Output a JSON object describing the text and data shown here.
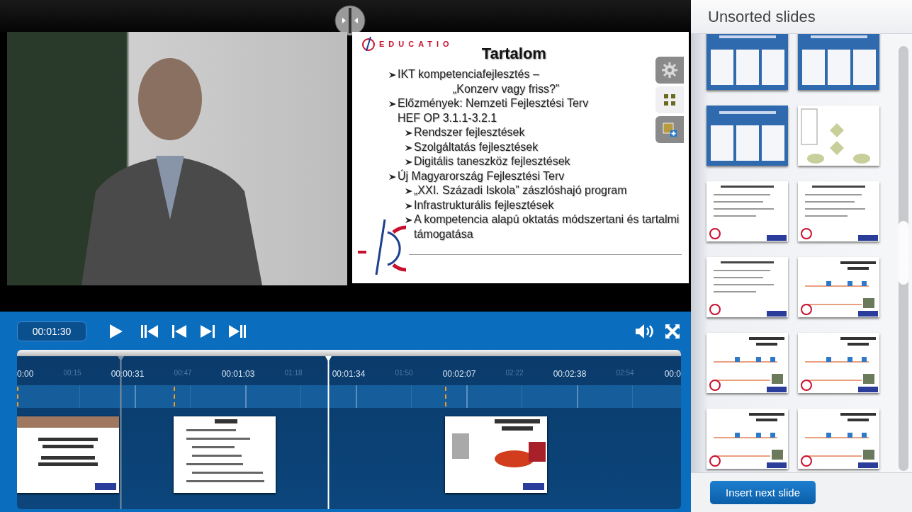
{
  "player": {
    "side_buttons": [
      {
        "kind": "settings",
        "selected": false
      },
      {
        "kind": "grid",
        "selected": true
      },
      {
        "kind": "add-image",
        "selected": false
      }
    ],
    "slide": {
      "logo": "EDUCATIO",
      "title": "Tartalom",
      "items": [
        {
          "text": "IKT kompetenciafejlesztés –",
          "continuation": "„Konzerv vagy friss?”"
        },
        {
          "text": "Előzmények: Nemzeti Fejlesztési Terv",
          "continuation": "HEF OP 3.1.1-3.2.1",
          "children": [
            {
              "text": "Rendszer fejlesztések"
            },
            {
              "text": "Szolgáltatás fejlesztések"
            },
            {
              "text": "Digitális taneszköz fejlesztések"
            }
          ]
        },
        {
          "text": "Új Magyarország Fejlesztési Terv",
          "children": [
            {
              "text": "„XXI. Századi Iskola” zászlóshajó program"
            },
            {
              "text": "Infrastrukturális fejlesztések"
            },
            {
              "text": "A kompetencia alapú oktatás módszertani és tartalmi támogatása"
            }
          ]
        }
      ]
    }
  },
  "controls": {
    "time": "00:01:30"
  },
  "timeline": {
    "ticks": [
      {
        "label": "0:00",
        "kind": "major"
      },
      {
        "label": "00:15",
        "kind": "minor"
      },
      {
        "label": "00:00:31",
        "kind": "major"
      },
      {
        "label": "00:47",
        "kind": "minor"
      },
      {
        "label": "00:01:03",
        "kind": "major"
      },
      {
        "label": "01:18",
        "kind": "minor"
      },
      {
        "label": "00:01:34",
        "kind": "major"
      },
      {
        "label": "01:50",
        "kind": "minor"
      },
      {
        "label": "00:02:07",
        "kind": "major"
      },
      {
        "label": "02:22",
        "kind": "minor"
      },
      {
        "label": "00:02:38",
        "kind": "major"
      },
      {
        "label": "02:54",
        "kind": "minor"
      },
      {
        "label": "00:0",
        "kind": "major"
      }
    ],
    "playhead": {
      "level": 0.469
    },
    "clips": [
      {
        "kind": "title"
      },
      {
        "kind": "text"
      },
      {
        "kind": "image"
      }
    ]
  },
  "unsorted": {
    "title": "Unsorted slides",
    "thumbnails": [
      {
        "kind": "blue"
      },
      {
        "kind": "blue"
      },
      {
        "kind": "blue"
      },
      {
        "kind": "diagram"
      },
      {
        "kind": "text"
      },
      {
        "kind": "text"
      },
      {
        "kind": "text"
      },
      {
        "kind": "timeline"
      },
      {
        "kind": "timeline"
      },
      {
        "kind": "timeline"
      },
      {
        "kind": "timeline"
      },
      {
        "kind": "timeline"
      }
    ],
    "button": "Insert next slide"
  }
}
